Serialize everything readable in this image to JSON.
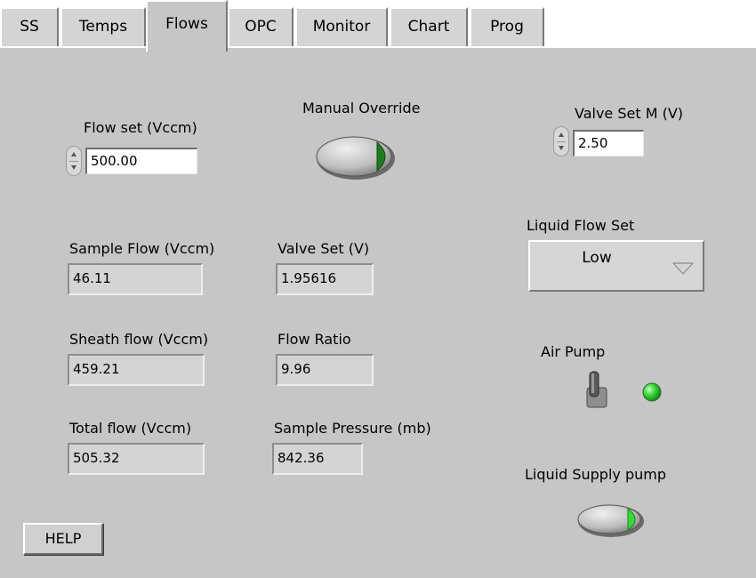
{
  "tabs": [
    {
      "label": "SS"
    },
    {
      "label": "Temps"
    },
    {
      "label": "Flows",
      "active": true
    },
    {
      "label": "OPC"
    },
    {
      "label": "Monitor"
    },
    {
      "label": "Chart"
    },
    {
      "label": "Prog"
    }
  ],
  "controls": {
    "flow_set": {
      "label": "Flow set (Vccm)",
      "value": "500.00"
    },
    "manual_override": {
      "label": "Manual Override",
      "state": "on"
    },
    "valve_set_m": {
      "label": "Valve Set M (V)",
      "value": "2.50"
    },
    "liquid_flow_set": {
      "label": "Liquid Flow Set",
      "value": "Low"
    },
    "air_pump": {
      "label": "Air Pump",
      "led": "on"
    },
    "liquid_supply_pump": {
      "label": "Liquid Supply pump",
      "state": "on"
    }
  },
  "indicators": {
    "sample_flow": {
      "label": "Sample Flow (Vccm)",
      "value": "46.11"
    },
    "valve_set": {
      "label": "Valve Set (V)",
      "value": "1.95616"
    },
    "sheath_flow": {
      "label": "Sheath flow (Vccm)",
      "value": "459.21"
    },
    "flow_ratio": {
      "label": "Flow Ratio",
      "value": "9.96"
    },
    "total_flow": {
      "label": "Total flow (Vccm)",
      "value": "505.32"
    },
    "sample_pressure": {
      "label": "Sample  Pressure (mb)",
      "value": "842.36"
    }
  },
  "help_button": {
    "label": "HELP"
  },
  "colors": {
    "panel": "#c6c6c6",
    "led_green": "#38d838",
    "override_indicator": "#1f7a1f"
  }
}
